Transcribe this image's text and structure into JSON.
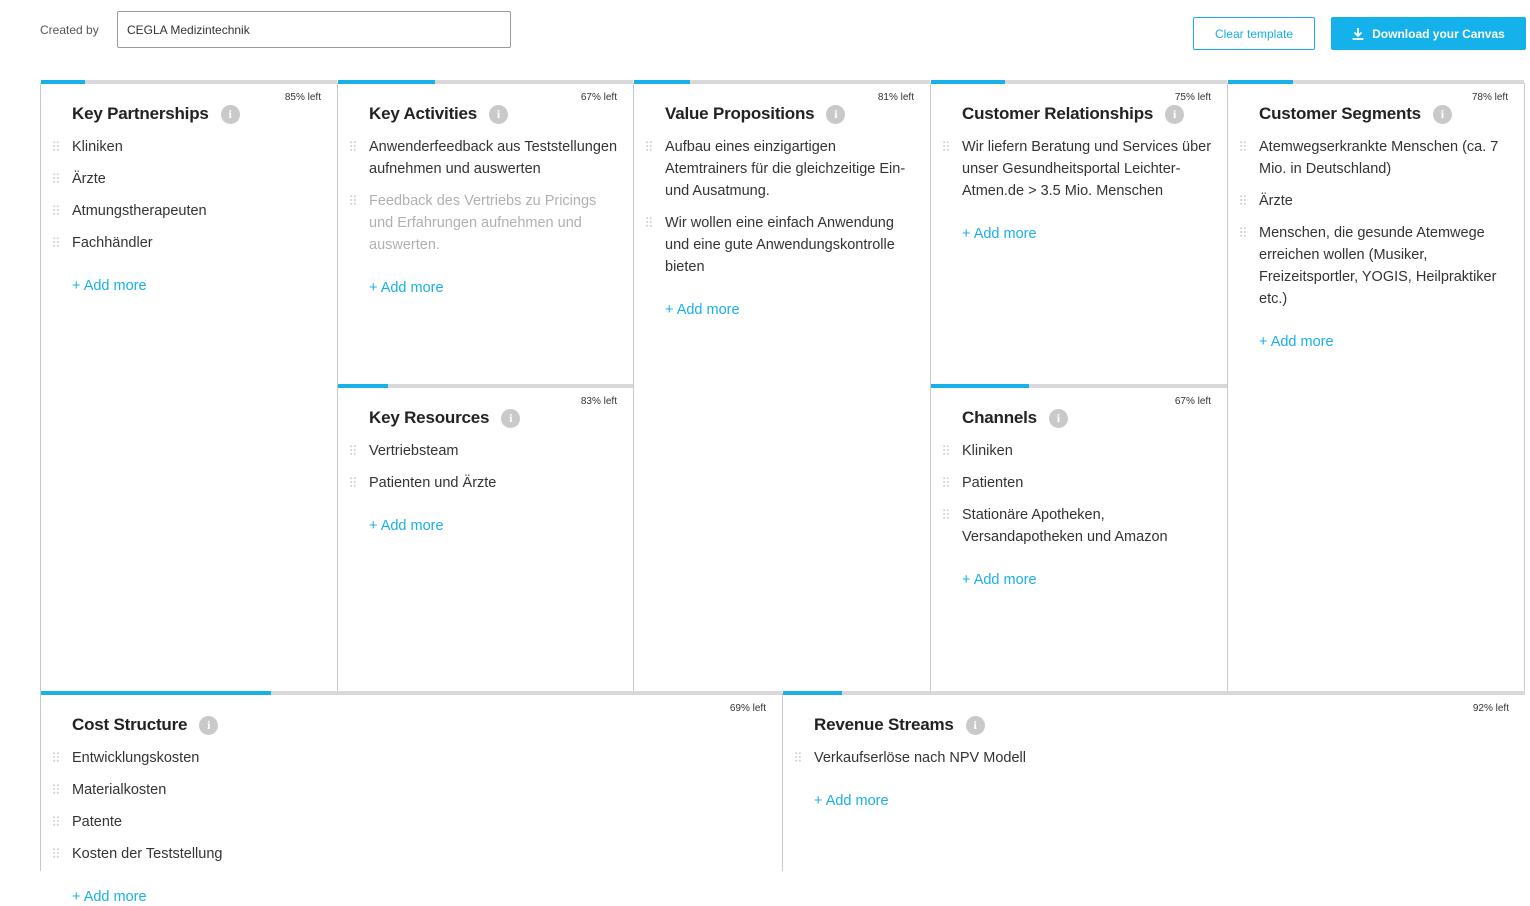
{
  "header": {
    "created_by_label": "Created by",
    "created_by_value": "CEGLA Medizintechnik",
    "clear_label": "Clear template",
    "download_label": "Download your Canvas"
  },
  "colors": {
    "accent": "#19b0e6",
    "track": "#d9d9d9",
    "border": "#c9c9c9"
  },
  "add_more_label": "+ Add more",
  "blocks": {
    "key_partnerships": {
      "title": "Key Partnerships",
      "pct": "85% left",
      "progress": 0.15,
      "items": [
        "Kliniken",
        "Ärzte",
        "Atmungstherapeuten",
        "Fachhändler"
      ]
    },
    "key_activities": {
      "title": "Key Activities",
      "pct": "67% left",
      "progress": 0.33,
      "items": [
        "Anwenderfeedback aus Teststellungen aufnehmen und auswerten",
        "Feedback des Vertriebs zu Pricings und Erfahrungen aufnehmen und auswerten."
      ]
    },
    "key_resources": {
      "title": "Key Resources",
      "pct": "83% left",
      "progress": 0.17,
      "items": [
        "Vertriebsteam",
        "Patienten und Ärzte"
      ]
    },
    "value_propositions": {
      "title": "Value Propositions",
      "pct": "81% left",
      "progress": 0.19,
      "items": [
        "Aufbau eines einzigartigen Atemtrainers für die gleichzeitige Ein- und Ausatmung.",
        "Wir wollen eine einfach Anwendung und eine gute Anwendungskontrolle bieten"
      ]
    },
    "customer_relationships": {
      "title": "Customer Relationships",
      "pct": "75% left",
      "progress": 0.25,
      "items": [
        "Wir liefern Beratung und Services über unser Gesundheitsportal Leichter-Atmen.de > 3.5 Mio. Menschen"
      ]
    },
    "channels": {
      "title": "Channels",
      "pct": "67% left",
      "progress": 0.33,
      "items": [
        "Kliniken",
        "Patienten",
        "Stationäre Apotheken, Versandapotheken und Amazon"
      ]
    },
    "customer_segments": {
      "title": "Customer Segments",
      "pct": "78% left",
      "progress": 0.22,
      "items": [
        "Atemwegserkrankte Menschen (ca. 7 Mio. in Deutschland)",
        "Ärzte",
        "Menschen, die gesunde Atemwege erreichen wollen (Musiker, Freizeitsportler, YOGIS, Heilpraktiker etc.)"
      ]
    },
    "cost_structure": {
      "title": "Cost Structure",
      "pct": "69% left",
      "progress": 0.31,
      "items": [
        "Entwicklungskosten",
        "Materialkosten",
        "Patente",
        "Kosten der Teststellung"
      ]
    },
    "revenue_streams": {
      "title": "Revenue Streams",
      "pct": "92% left",
      "progress": 0.08,
      "items": [
        "Verkaufserlöse nach NPV Modell"
      ]
    }
  }
}
